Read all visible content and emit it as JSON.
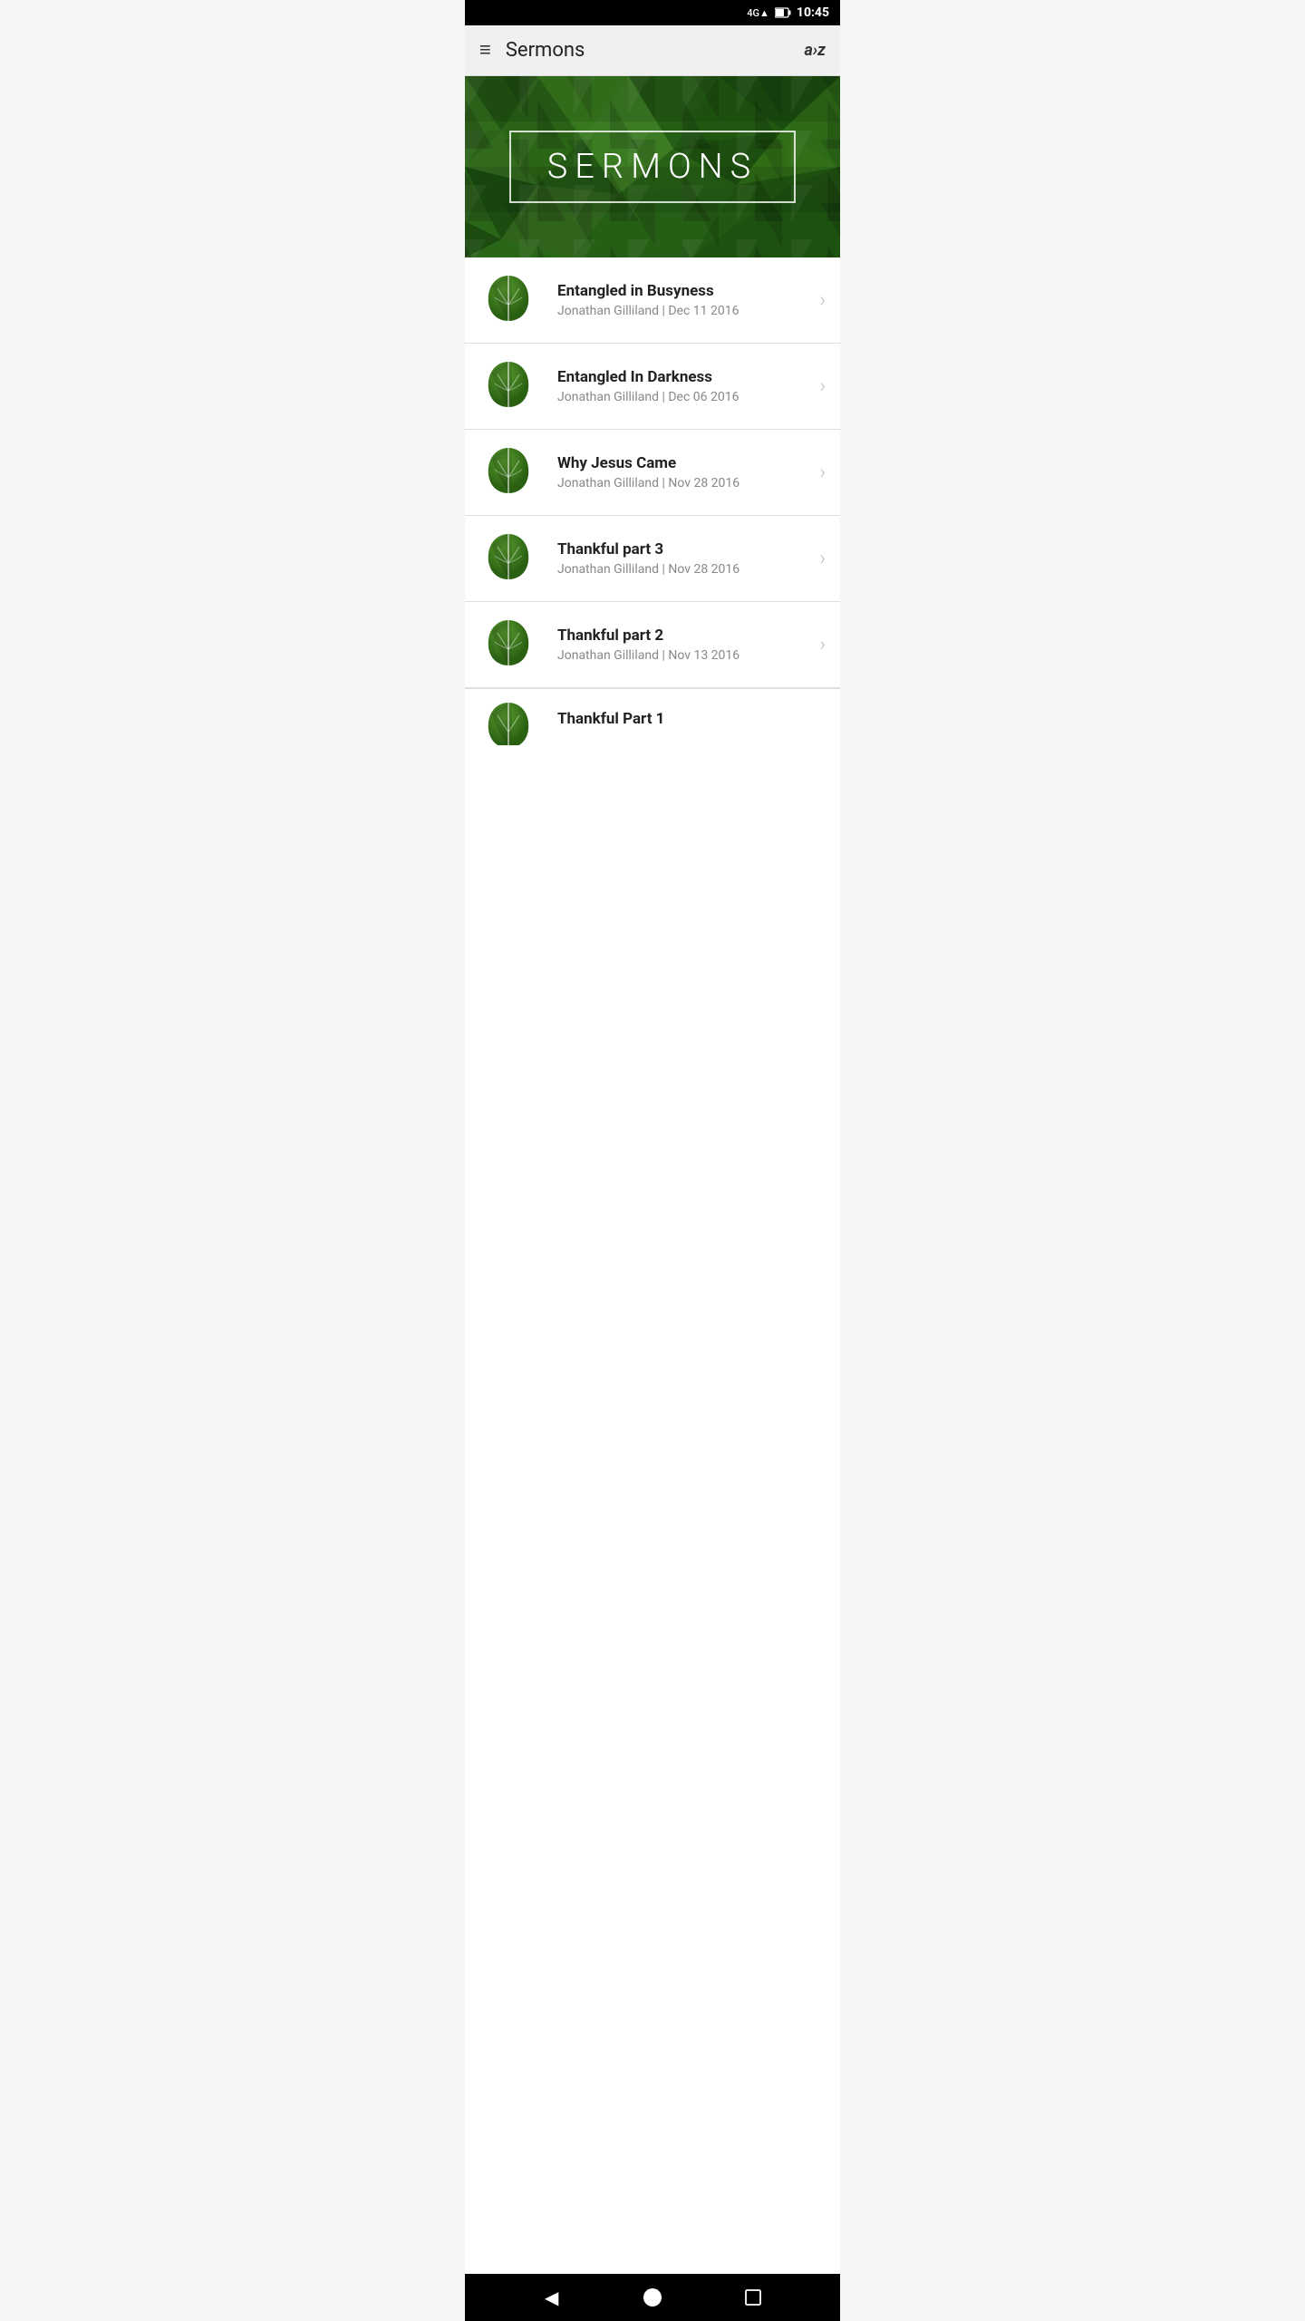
{
  "status_bar": {
    "network": "4G",
    "time": "10:45"
  },
  "app_bar": {
    "title": "Sermons",
    "menu_icon": "≡",
    "az_label": "a›z"
  },
  "hero": {
    "text": "SERMONS"
  },
  "sermons": [
    {
      "title": "Entangled in Busyness",
      "speaker": "Jonathan Gilliland",
      "date": "Dec 11 2016"
    },
    {
      "title": "Entangled In Darkness",
      "speaker": "Jonathan Gilliland",
      "date": "Dec 06 2016"
    },
    {
      "title": "Why Jesus Came",
      "speaker": "Jonathan Gilliland",
      "date": "Nov 28 2016"
    },
    {
      "title": "Thankful part 3",
      "speaker": "Jonathan Gilliland",
      "date": "Nov 28 2016"
    },
    {
      "title": "Thankful part 2",
      "speaker": "Jonathan Gilliland",
      "date": "Nov 13 2016"
    }
  ],
  "partial_sermon": {
    "title": "Thankful Part 1"
  },
  "bottom_nav": {
    "back": "◀",
    "home": "●",
    "recent": "■"
  },
  "colors": {
    "accent_green": "#2d7a1a",
    "dark_green": "#1a4a10"
  }
}
